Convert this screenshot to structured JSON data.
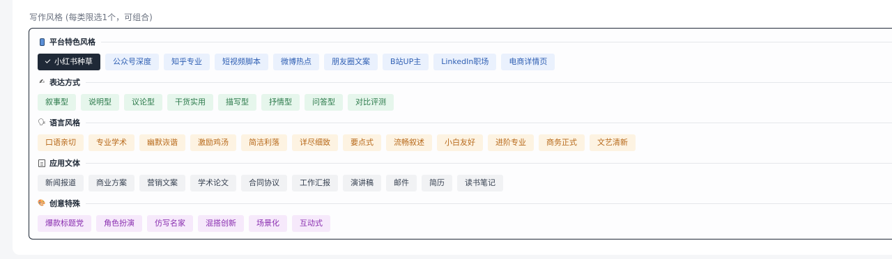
{
  "form": {
    "label": "写作风格 (每类限选1个，可组合)"
  },
  "groups": [
    {
      "title": "平台特色风格",
      "icon": "mobile-phone-icon",
      "color": "#2f5fb3",
      "chips": [
        "小红书种草",
        "公众号深度",
        "知乎专业",
        "短视频脚本",
        "微博热点",
        "朋友圈文案",
        "B站UP主",
        "LinkedIn职场",
        "电商详情页"
      ],
      "selected": "小红书种草"
    },
    {
      "title": "表达方式",
      "icon": "writing-hand-icon",
      "color": "#2c7a4b",
      "chips": [
        "叙事型",
        "说明型",
        "议论型",
        "干货实用",
        "描写型",
        "抒情型",
        "问答型",
        "对比评测"
      ]
    },
    {
      "title": "语言风格",
      "icon": "speaking-head-icon",
      "color": "#b7691a",
      "chips": [
        "口语亲切",
        "专业学术",
        "幽默诙谐",
        "激励鸡汤",
        "简洁利落",
        "详尽细致",
        "要点式",
        "流畅叙述",
        "小白友好",
        "进阶专业",
        "商务正式",
        "文艺清新"
      ]
    },
    {
      "title": "应用文体",
      "icon": "document-icon",
      "color": "#374151",
      "chips": [
        "新闻报道",
        "商业方案",
        "营销文案",
        "学术论文",
        "合同协议",
        "工作汇报",
        "演讲稿",
        "邮件",
        "简历",
        "读书笔记"
      ]
    },
    {
      "title": "创意特殊",
      "icon": "palette-icon",
      "color": "#8a2fb0",
      "chips": [
        "爆款标题党",
        "角色扮演",
        "仿写名家",
        "混搭创新",
        "场景化",
        "互动式"
      ]
    }
  ]
}
